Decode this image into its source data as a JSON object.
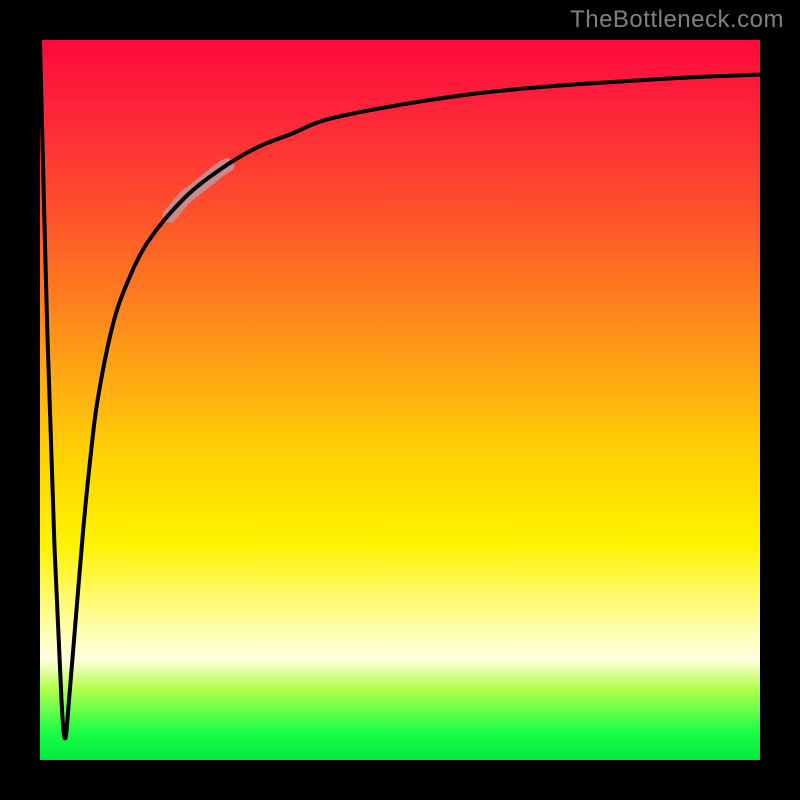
{
  "watermark": "TheBottleneck.com",
  "colors": {
    "frame": "#000000",
    "curve": "#000000",
    "highlight": "#c88a8a",
    "watermark": "#808080"
  },
  "chart_data": {
    "type": "line",
    "title": "",
    "xlabel": "",
    "ylabel": "",
    "xlim": [
      0,
      100
    ],
    "ylim": [
      0,
      100
    ],
    "grid": false,
    "legend": false,
    "series": [
      {
        "name": "curve",
        "x": [
          0,
          1,
          2,
          3,
          3.5,
          4,
          5,
          6,
          7,
          8,
          10,
          12,
          15,
          20,
          25,
          30,
          35,
          40,
          50,
          60,
          70,
          80,
          90,
          100
        ],
        "y": [
          100,
          60,
          30,
          8,
          3,
          8,
          20,
          32,
          42,
          50,
          60,
          66,
          72,
          78,
          82,
          85,
          87,
          89,
          91,
          92.5,
          93.5,
          94.2,
          94.8,
          95.2
        ]
      }
    ],
    "highlight_segment": {
      "series": "curve",
      "x_start": 18,
      "x_end": 26,
      "note": "thicker pale-rose segment on the ascending bend"
    },
    "gradient_stops": [
      {
        "pos": 0.0,
        "color": "#ff0a3a"
      },
      {
        "pos": 0.22,
        "color": "#ff4a2e"
      },
      {
        "pos": 0.48,
        "color": "#ffae12"
      },
      {
        "pos": 0.7,
        "color": "#fff200"
      },
      {
        "pos": 0.86,
        "color": "#ffffe0"
      },
      {
        "pos": 0.96,
        "color": "#1eff47"
      },
      {
        "pos": 1.0,
        "color": "#00e83e"
      }
    ]
  }
}
